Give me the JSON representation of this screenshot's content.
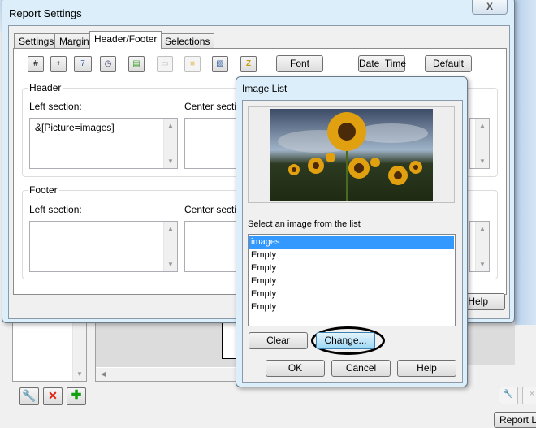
{
  "report_settings": {
    "title": "Report Settings",
    "close_glyph": "X",
    "tabs": [
      "Settings",
      "Margins",
      "Header/Footer",
      "Selections"
    ],
    "toolbar": {
      "font": "Font",
      "date_time": "Date  Time",
      "default": "Default"
    },
    "header": {
      "label": "Header",
      "left_label": "Left section:",
      "center_label": "Center section:",
      "left_value": "&[Picture=images]"
    },
    "footer": {
      "label": "Footer",
      "left_label": "Left section:",
      "center_label": "Center section:"
    },
    "help": "Help"
  },
  "image_list": {
    "title": "Image List",
    "prompt": "Select an image from the list",
    "items": [
      "images",
      "Empty",
      "Empty",
      "Empty",
      "Empty",
      "Empty"
    ],
    "selected_index": 0,
    "clear": "Clear",
    "change": "Change...",
    "ok": "OK",
    "cancel": "Cancel",
    "help": "Help"
  },
  "background": {
    "report_button": "Report Li"
  },
  "colors": {
    "selection": "#3399ff",
    "window_frame": "#dbeefa"
  }
}
